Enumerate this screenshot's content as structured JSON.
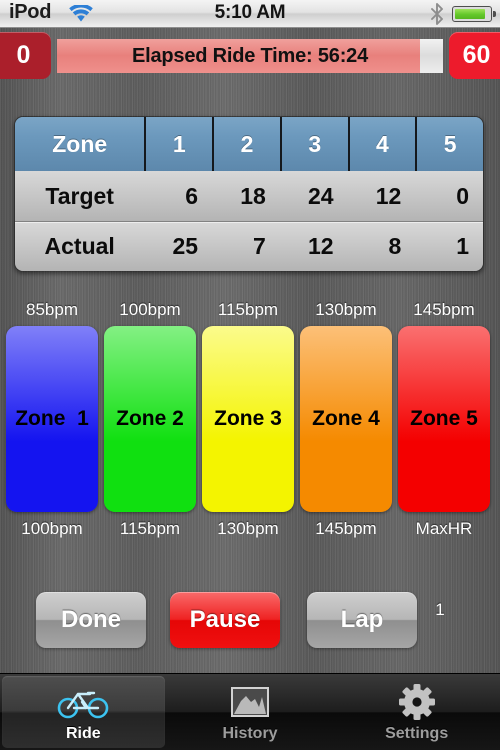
{
  "status_bar": {
    "carrier": "iPod",
    "time": "5:10 AM",
    "wifi_icon": "wifi-icon",
    "bluetooth_icon": "bluetooth-icon",
    "battery_icon": "battery-icon"
  },
  "timer": {
    "left_badge": "0",
    "right_badge": "60",
    "label": "Elapsed Ride Time: 56:24",
    "progress_percent": 94,
    "fill_color": "#e8807c",
    "track_color": "#e3e3e3",
    "left_badge_color": "#ab1f2b",
    "right_badge_color": "#ed1b2c"
  },
  "zone_table": {
    "header": [
      "Zone",
      "1",
      "2",
      "3",
      "4",
      "5"
    ],
    "rows": [
      {
        "label": "Target",
        "values": [
          "6",
          "18",
          "24",
          "12",
          "0"
        ],
        "highlight": [
          false,
          false,
          false,
          false,
          false
        ]
      },
      {
        "label": "Actual",
        "values": [
          "25",
          "7",
          "12",
          "8",
          "1"
        ],
        "highlight": [
          true,
          false,
          false,
          false,
          true
        ]
      }
    ],
    "header_color": "#6c99bd",
    "highlight_color": "#ee1c1c"
  },
  "zone_bars": [
    {
      "name": "Zone  1",
      "top_label": "85bpm",
      "bottom_label": "100bpm",
      "color_top": "#8080f8",
      "color_bottom": "#1414f0"
    },
    {
      "name": "Zone 2",
      "top_label": "100bpm",
      "bottom_label": "115bpm",
      "color_top": "#84f084",
      "color_bottom": "#10e010"
    },
    {
      "name": "Zone 3",
      "top_label": "115bpm",
      "bottom_label": "130bpm",
      "color_top": "#fbfb8c",
      "color_bottom": "#f4f400"
    },
    {
      "name": "Zone 4",
      "top_label": "130bpm",
      "bottom_label": "145bpm",
      "color_top": "#fcc078",
      "color_bottom": "#f58a00"
    },
    {
      "name": "Zone 5",
      "top_label": "145bpm",
      "bottom_label": "MaxHR",
      "color_top": "#fa7070",
      "color_bottom": "#f40000"
    }
  ],
  "actions": {
    "done_label": "Done",
    "pause_label": "Pause",
    "lap_label": "Lap",
    "lap_count": "1"
  },
  "tabs": [
    {
      "label": "Ride",
      "icon": "bicycle-icon",
      "active": true
    },
    {
      "label": "History",
      "icon": "chart-icon",
      "active": false
    },
    {
      "label": "Settings",
      "icon": "gear-icon",
      "active": false
    }
  ]
}
